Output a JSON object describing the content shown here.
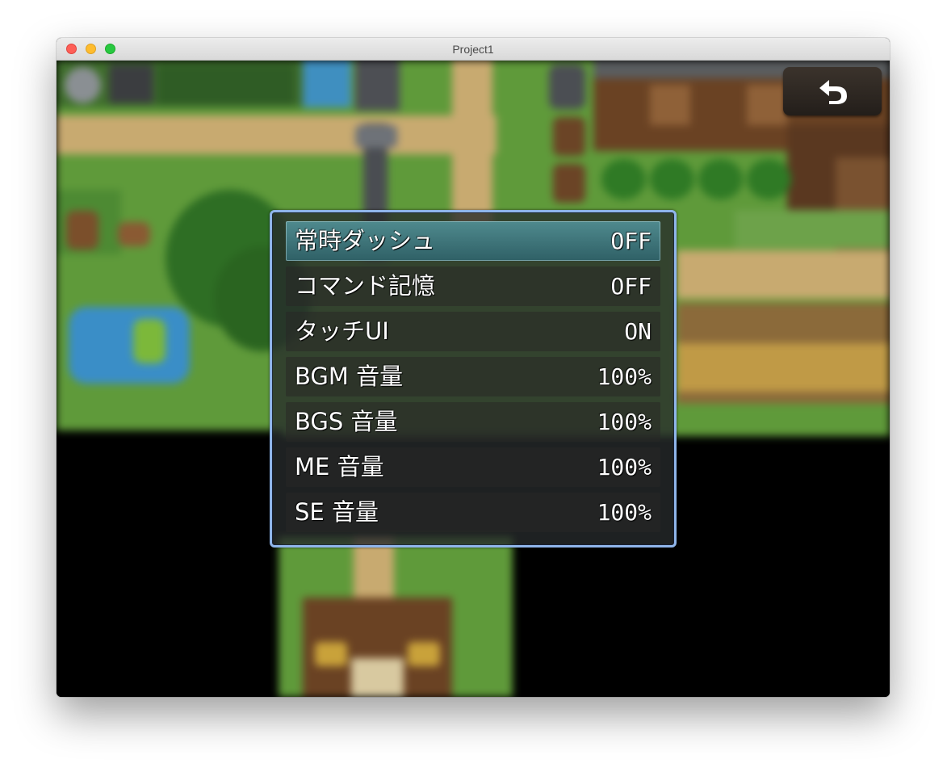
{
  "window": {
    "title": "Project1"
  },
  "menu_button": {
    "icon": "return-arrow-icon"
  },
  "options": [
    {
      "label": "常時ダッシュ",
      "value": "OFF",
      "selected": true
    },
    {
      "label": "コマンド記憶",
      "value": "OFF",
      "selected": false
    },
    {
      "label": "タッチUI",
      "value": "ON",
      "selected": false
    },
    {
      "label": "BGM 音量",
      "value": "100%",
      "selected": false
    },
    {
      "label": "BGS 音量",
      "value": "100%",
      "selected": false
    },
    {
      "label": "ME 音量",
      "value": "100%",
      "selected": false
    },
    {
      "label": "SE 音量",
      "value": "100%",
      "selected": false
    }
  ],
  "colors": {
    "window_border": "#8fb5ea",
    "selection": "#3f767b",
    "grass": "#5f9a3a",
    "dirt": "#c4a46c"
  }
}
